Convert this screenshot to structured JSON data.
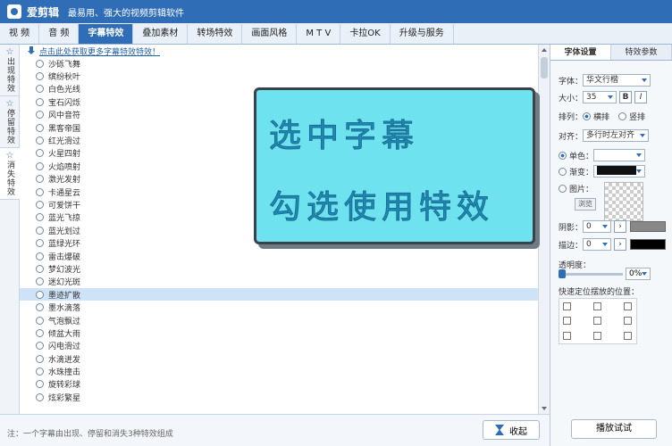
{
  "app": {
    "title": "爱剪辑",
    "subtitle": "最易用、强大的视频剪辑软件"
  },
  "tabs": [
    "视 频",
    "音 频",
    "字幕特效",
    "叠加素材",
    "转场特效",
    "画面风格",
    "M T V",
    "卡拉OK",
    "升级与服务"
  ],
  "side_tabs": [
    "出现特效",
    "停留特效",
    "消失特效"
  ],
  "list": {
    "download_link": "点击此处获取更多字幕特效特效！",
    "items": [
      "沙砾飞舞",
      "缤纷秋叶",
      "白色光线",
      "宝石闪烁",
      "风中音符",
      "黑客帝国",
      "红光滑过",
      "火星四射",
      "火焰喷射",
      "激光发射",
      "卡通星云",
      "可爱饼干",
      "蓝光飞掠",
      "蓝光划过",
      "蓝绿光环",
      "雷击爆破",
      "梦幻波光",
      "迷幻光斑",
      "墨迹扩散",
      "墨水滴落",
      "气泡飘过",
      "倾盆大雨",
      "闪电滑过",
      "水滴迸发",
      "水珠撞击",
      "旋转彩球",
      "炫彩繁星"
    ],
    "selected": "墨迹扩散"
  },
  "bottom": {
    "note": "注：一个字幕由出现、停留和消失3种特效组成",
    "collapse": "收起"
  },
  "panel": {
    "tabs": [
      "字体设置",
      "特效参数"
    ],
    "font_label": "字体：",
    "font_value": "华文行楷",
    "size_label": "大小：",
    "size_value": "35",
    "bold": "B",
    "italic": "I",
    "layout_label": "排列：",
    "layout_h": "横排",
    "layout_v": "竖排",
    "align_label": "对齐：",
    "align_value": "多行时左对齐",
    "solid_label": "单色：",
    "gradient_label": "渐变：",
    "image_label": "图片：",
    "browse": "浏览",
    "shadow_label": "阴影：",
    "shadow_value": "0",
    "stroke_label": "描边：",
    "stroke_value": "0",
    "opacity_label": "透明度：",
    "opacity_value": "0%",
    "position_label": "快速定位摆放的位置：",
    "play": "播放试试",
    "colors": {
      "shadow": "#888888",
      "stroke": "#000000",
      "gradient": "#111111"
    }
  },
  "overlay": {
    "line1": "选中字幕",
    "line2": "勾选使用特效"
  }
}
